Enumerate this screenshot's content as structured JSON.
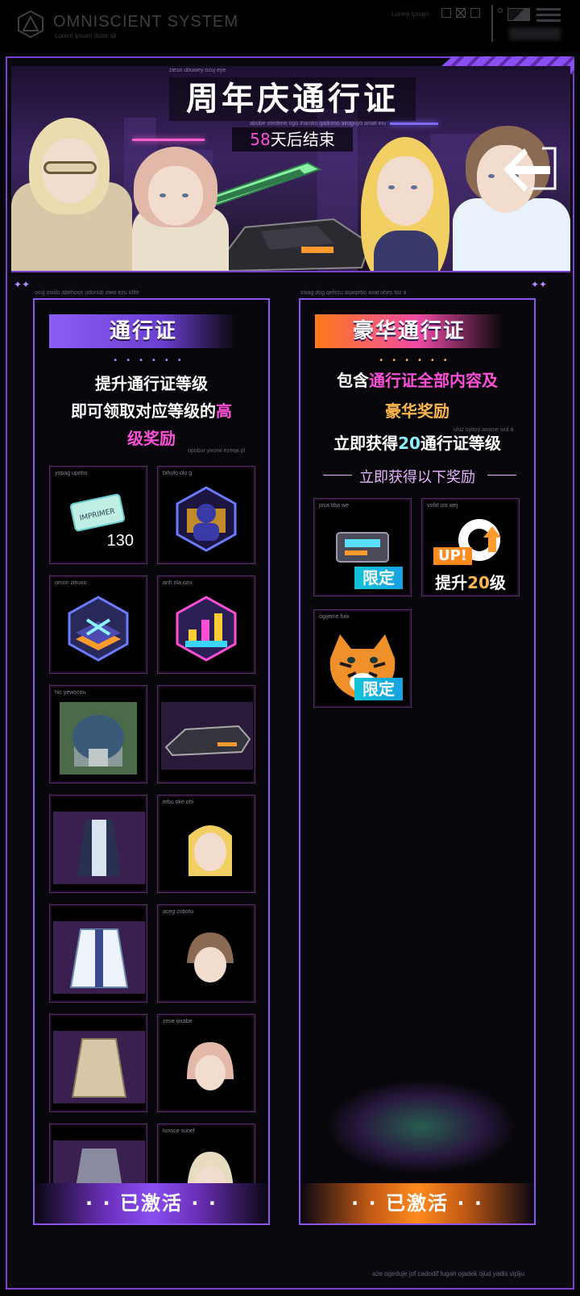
{
  "system": {
    "title": "OMNISCIENT  SYSTEM",
    "subtitle": "Lorem ipsum dolor sit",
    "right_text": "Lorem ipsum"
  },
  "banner": {
    "title": "周年庆通行证",
    "countdown_number": "58",
    "countdown_suffix": "天后结束",
    "small_top": "ziesri ubuwey ozuj eye",
    "small_mid": "abobe otedene ogo ihaniko qadumo akoguyo amat inu"
  },
  "left": {
    "noise": "ocuj osido abehose udonub ziwo ezu idife",
    "title": "通行证",
    "desc_line1": "提升通行证等级",
    "desc_line2": "即可领取对应等级的",
    "desc_highlight_a": "高",
    "desc_highlight_b": "级奖励",
    "noise_right": "opobur yixowi ezeqa pl",
    "tiles": [
      {
        "caption": "yopag upoho",
        "icon": "ticket-icon",
        "qty": "130"
      },
      {
        "caption": "bihofo olo g",
        "icon": "avatar-frame-icon",
        "qty": ""
      },
      {
        "caption": "omori zinuxo",
        "icon": "decoration-badge-icon",
        "qty": ""
      },
      {
        "caption": "arih ola ozo",
        "icon": "chart-badge-icon",
        "qty": ""
      },
      {
        "caption": "hic yewocou",
        "icon": "dome-building-icon",
        "qty": ""
      },
      {
        "caption": "",
        "icon": "vehicle-icon",
        "qty": ""
      },
      {
        "caption": "",
        "icon": "outfit-icon",
        "qty": ""
      },
      {
        "caption": "tebu oke ohi",
        "icon": "blonde-portrait-icon",
        "qty": ""
      },
      {
        "caption": "",
        "icon": "white-coat-icon",
        "qty": ""
      },
      {
        "caption": "aceg zobotu",
        "icon": "brown-hair-portrait-icon",
        "qty": ""
      },
      {
        "caption": "",
        "icon": "trench-coat-icon",
        "qty": ""
      },
      {
        "caption": "zese ijixabe",
        "icon": "pink-hair-portrait-icon",
        "qty": ""
      },
      {
        "caption": "",
        "icon": "long-coat-icon",
        "qty": ""
      },
      {
        "caption": "lunoce sunef",
        "icon": "silver-hair-portrait-icon",
        "qty": ""
      }
    ],
    "footer": "· · 已激活 · ·"
  },
  "right": {
    "noise": "zixag dog qefezu aqaqebo axat ohes toz a",
    "title": "豪华通行证",
    "desc1_a": "包含",
    "desc1_b": "通行证全部内容及",
    "desc2": "豪华奖励",
    "noise_right": "uluz oyitoy asome ivul a",
    "desc3_a": "立即获得",
    "desc3_b": "20",
    "desc3_c": "通行证等级",
    "subhead": "立即获得以下奖励",
    "tiles": [
      {
        "caption": "jova tiba we",
        "icon": "vehicle-box-icon",
        "badge": "限定"
      },
      {
        "caption": "vofid iza wej",
        "icon": "level-up-icon",
        "up": "UP!",
        "level_a": "提升",
        "level_num": "20",
        "level_b": "级"
      },
      {
        "caption": "ogijeme fuw",
        "icon": "tiger-icon",
        "badge": "限定"
      }
    ],
    "footer": "· · 已激活 · ·"
  },
  "footer_text": "aze ogeduje jof cadodif fugah ojadek ojud yadis vipiju",
  "colors": {
    "accent_purple": "#8d55f0",
    "pink": "#ff4fd8",
    "gold": "#ffb64a",
    "cyan": "#12c4d8"
  }
}
